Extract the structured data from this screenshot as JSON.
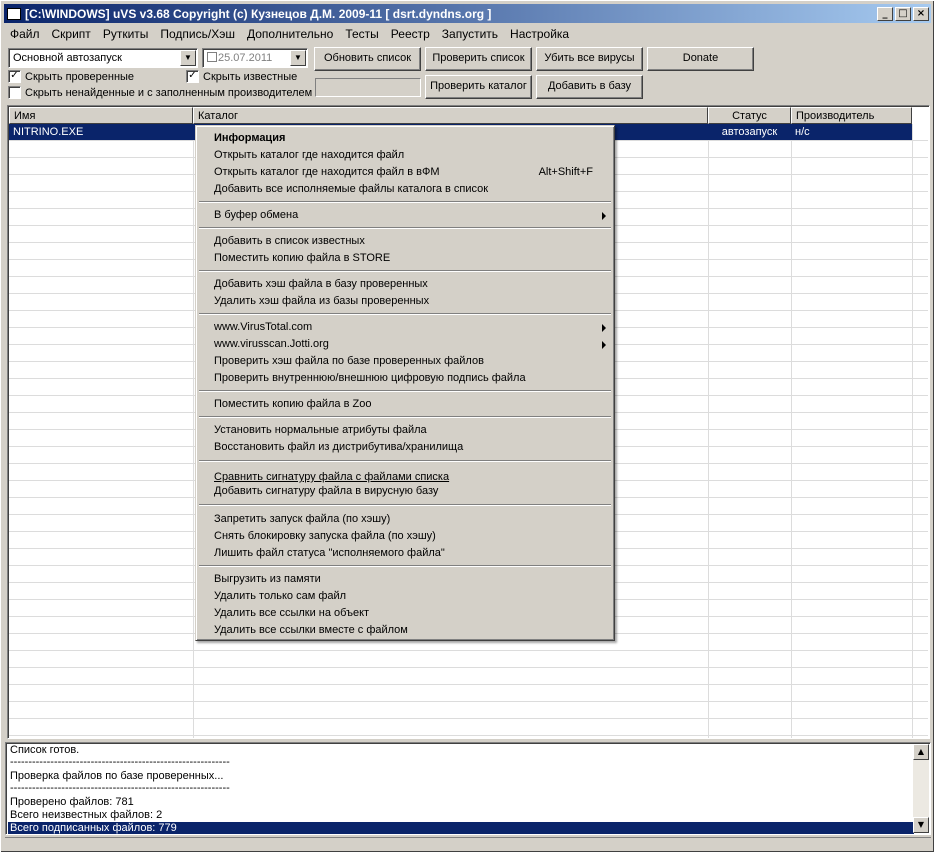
{
  "window": {
    "title": "[C:\\WINDOWS] uVS v3.68 Copyright (c) Кузнецов Д.М. 2009-11 [ dsrt.dyndns.org ]",
    "minimize": "_",
    "maximize": "□",
    "close": "×"
  },
  "menubar": [
    "Файл",
    "Скрипт",
    "Руткиты",
    "Подпись/Хэш",
    "Дополнительно",
    "Тесты",
    "Реестр",
    "Запустить",
    "Настройка"
  ],
  "toolbar": {
    "mode_select": "Основной автозапуск",
    "date_value": "25.07.2011",
    "refresh_button": "Обновить список",
    "check_list_button": "Проверить список",
    "kill_viruses_button": "Убить все вирусы",
    "donate_button": "Donate",
    "check_folder_button": "Проверить каталог",
    "add_to_db_button": "Добавить в базу",
    "hide_checked_label": "Скрыть проверенные",
    "hide_known_label": "Скрыть известные",
    "hide_not_found_label": "Скрыть ненайденные и с заполненным производителем",
    "check_mark": "✓"
  },
  "grid": {
    "columns": [
      "Имя",
      "Каталог",
      "Статус",
      "Производитель"
    ],
    "rows": [
      {
        "name": "NITRINO.EXE",
        "folder": "",
        "status": "автозапуск",
        "vendor": "н/с"
      }
    ]
  },
  "context_menu": {
    "items": [
      {
        "label": "Информация",
        "bold": true
      },
      {
        "label": "Открыть каталог где находится файл"
      },
      {
        "label": "Открыть каталог где находится файл в вФМ",
        "shortcut": "Alt+Shift+F"
      },
      {
        "label": "Добавить все исполняемые файлы каталога в список"
      },
      {
        "label": "В буфер обмена",
        "submenu": true
      },
      {
        "label": "Добавить в список известных"
      },
      {
        "label": "Поместить копию файла в STORE"
      },
      {
        "label": "Добавить хэш файла в базу проверенных"
      },
      {
        "label": "Удалить хэш файла из базы проверенных"
      },
      {
        "label": "www.VirusTotal.com",
        "submenu": true
      },
      {
        "label": "www.virusscan.Jotti.org",
        "submenu": true
      },
      {
        "label": "Проверить хэш файла по базе проверенных файлов"
      },
      {
        "label": "Проверить внутреннюю/внешнюю цифровую подпись файла"
      },
      {
        "label": "Поместить копию файла в Zoo"
      },
      {
        "label": "Установить нормальные атрибуты файла"
      },
      {
        "label": "Восстановить файл из дистрибутива/хранилища"
      },
      {
        "label": "Сравнить сигнатуру файла с файлами списка",
        "underline": true
      },
      {
        "label": "Добавить сигнатуру файла в вирусную базу"
      },
      {
        "label": "Запретить запуск файла (по хэшу)"
      },
      {
        "label": "Снять блокировку запуска файла (по хэшу)"
      },
      {
        "label": "Лишить файл статуса \"исполняемого файла\""
      },
      {
        "label": "Выгрузить из памяти"
      },
      {
        "label": "Удалить только сам файл"
      },
      {
        "label": "Удалить все ссылки на объект"
      },
      {
        "label": "Удалить все ссылки вместе с файлом"
      }
    ]
  },
  "log": {
    "lines": [
      "Список готов.",
      "------------------------------------------------------------",
      "Проверка файлов по базе проверенных...",
      "------------------------------------------------------------",
      "Проверено файлов: 781",
      "Всего неизвестных файлов: 2",
      "Всего подписанных файлов: 779"
    ],
    "scroll_up": "▲",
    "scroll_down": "▼"
  }
}
